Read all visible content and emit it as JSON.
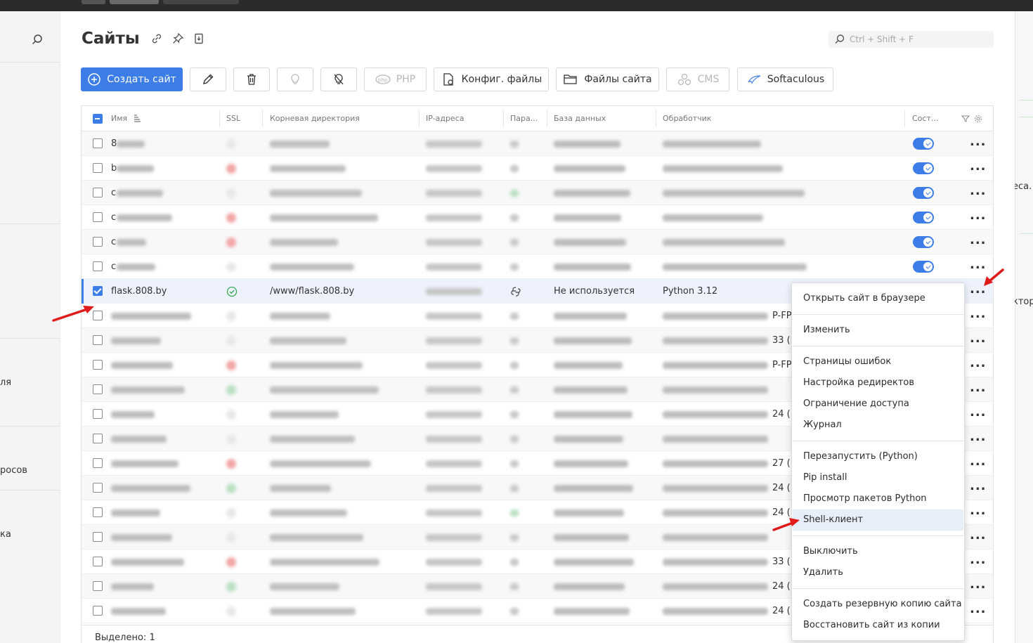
{
  "page": {
    "title": "Сайты",
    "search_placeholder": "Ctrl + Shift + F"
  },
  "sidebar": {
    "fragments": [
      "ля",
      "росов",
      "ка"
    ]
  },
  "rightstrip": {
    "fragments": [
      "еса.",
      "ктор"
    ]
  },
  "toolbar": {
    "create": "Создать сайт",
    "php": "PHP",
    "config": "Конфиг. файлы",
    "files": "Файлы сайта",
    "cms": "CMS",
    "softaculous": "Softaculous"
  },
  "table": {
    "columns": [
      "Имя",
      "SSL",
      "Корневая директория",
      "IP-адреса",
      "Пара...",
      "База данных",
      "Обработчик",
      "Сост..."
    ],
    "selected_row": {
      "name": "flask.808.by",
      "root": "/www/flask.808.by",
      "database": "Не используется",
      "handler": "Python 3.12"
    },
    "row_first_chars": [
      "8",
      "b",
      "c",
      "c",
      "c",
      "c"
    ],
    "row_handler_fragments": [
      "P-FP",
      "33 (г",
      "P-FP",
      "",
      "24 (",
      "",
      "27 (",
      "24 (",
      "24 (",
      "",
      "33 (",
      "24 (",
      "24 ("
    ],
    "footer": "Выделено: 1"
  },
  "context_menu": {
    "groups": [
      [
        "Открыть сайт в браузере"
      ],
      [
        "Изменить"
      ],
      [
        "Страницы ошибок",
        "Настройка редиректов",
        "Ограничение доступа",
        "Журнал"
      ],
      [
        "Перезапустить (Python)",
        "Pip install",
        "Просмотр пакетов Python",
        "Shell-клиент"
      ],
      [
        "Выключить",
        "Удалить"
      ],
      [
        "Создать резервную копию сайта",
        "Восстановить сайт из копии"
      ]
    ]
  }
}
